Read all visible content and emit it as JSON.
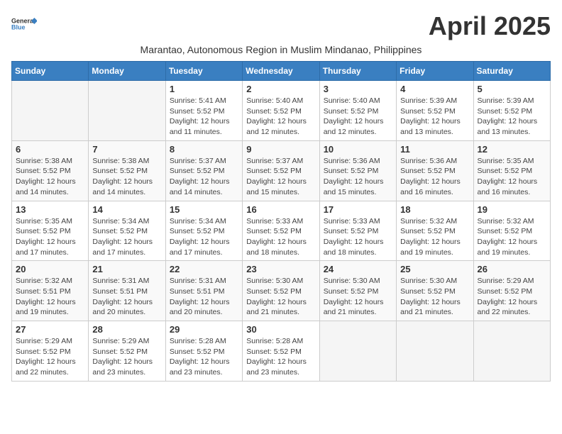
{
  "logo": {
    "text_general": "General",
    "text_blue": "Blue"
  },
  "title": "April 2025",
  "subtitle": "Marantao, Autonomous Region in Muslim Mindanao, Philippines",
  "days_of_week": [
    "Sunday",
    "Monday",
    "Tuesday",
    "Wednesday",
    "Thursday",
    "Friday",
    "Saturday"
  ],
  "weeks": [
    [
      {
        "day": "",
        "info": ""
      },
      {
        "day": "",
        "info": ""
      },
      {
        "day": "1",
        "info": "Sunrise: 5:41 AM\nSunset: 5:52 PM\nDaylight: 12 hours and 11 minutes."
      },
      {
        "day": "2",
        "info": "Sunrise: 5:40 AM\nSunset: 5:52 PM\nDaylight: 12 hours and 12 minutes."
      },
      {
        "day": "3",
        "info": "Sunrise: 5:40 AM\nSunset: 5:52 PM\nDaylight: 12 hours and 12 minutes."
      },
      {
        "day": "4",
        "info": "Sunrise: 5:39 AM\nSunset: 5:52 PM\nDaylight: 12 hours and 13 minutes."
      },
      {
        "day": "5",
        "info": "Sunrise: 5:39 AM\nSunset: 5:52 PM\nDaylight: 12 hours and 13 minutes."
      }
    ],
    [
      {
        "day": "6",
        "info": "Sunrise: 5:38 AM\nSunset: 5:52 PM\nDaylight: 12 hours and 14 minutes."
      },
      {
        "day": "7",
        "info": "Sunrise: 5:38 AM\nSunset: 5:52 PM\nDaylight: 12 hours and 14 minutes."
      },
      {
        "day": "8",
        "info": "Sunrise: 5:37 AM\nSunset: 5:52 PM\nDaylight: 12 hours and 14 minutes."
      },
      {
        "day": "9",
        "info": "Sunrise: 5:37 AM\nSunset: 5:52 PM\nDaylight: 12 hours and 15 minutes."
      },
      {
        "day": "10",
        "info": "Sunrise: 5:36 AM\nSunset: 5:52 PM\nDaylight: 12 hours and 15 minutes."
      },
      {
        "day": "11",
        "info": "Sunrise: 5:36 AM\nSunset: 5:52 PM\nDaylight: 12 hours and 16 minutes."
      },
      {
        "day": "12",
        "info": "Sunrise: 5:35 AM\nSunset: 5:52 PM\nDaylight: 12 hours and 16 minutes."
      }
    ],
    [
      {
        "day": "13",
        "info": "Sunrise: 5:35 AM\nSunset: 5:52 PM\nDaylight: 12 hours and 17 minutes."
      },
      {
        "day": "14",
        "info": "Sunrise: 5:34 AM\nSunset: 5:52 PM\nDaylight: 12 hours and 17 minutes."
      },
      {
        "day": "15",
        "info": "Sunrise: 5:34 AM\nSunset: 5:52 PM\nDaylight: 12 hours and 17 minutes."
      },
      {
        "day": "16",
        "info": "Sunrise: 5:33 AM\nSunset: 5:52 PM\nDaylight: 12 hours and 18 minutes."
      },
      {
        "day": "17",
        "info": "Sunrise: 5:33 AM\nSunset: 5:52 PM\nDaylight: 12 hours and 18 minutes."
      },
      {
        "day": "18",
        "info": "Sunrise: 5:32 AM\nSunset: 5:52 PM\nDaylight: 12 hours and 19 minutes."
      },
      {
        "day": "19",
        "info": "Sunrise: 5:32 AM\nSunset: 5:52 PM\nDaylight: 12 hours and 19 minutes."
      }
    ],
    [
      {
        "day": "20",
        "info": "Sunrise: 5:32 AM\nSunset: 5:51 PM\nDaylight: 12 hours and 19 minutes."
      },
      {
        "day": "21",
        "info": "Sunrise: 5:31 AM\nSunset: 5:51 PM\nDaylight: 12 hours and 20 minutes."
      },
      {
        "day": "22",
        "info": "Sunrise: 5:31 AM\nSunset: 5:51 PM\nDaylight: 12 hours and 20 minutes."
      },
      {
        "day": "23",
        "info": "Sunrise: 5:30 AM\nSunset: 5:52 PM\nDaylight: 12 hours and 21 minutes."
      },
      {
        "day": "24",
        "info": "Sunrise: 5:30 AM\nSunset: 5:52 PM\nDaylight: 12 hours and 21 minutes."
      },
      {
        "day": "25",
        "info": "Sunrise: 5:30 AM\nSunset: 5:52 PM\nDaylight: 12 hours and 21 minutes."
      },
      {
        "day": "26",
        "info": "Sunrise: 5:29 AM\nSunset: 5:52 PM\nDaylight: 12 hours and 22 minutes."
      }
    ],
    [
      {
        "day": "27",
        "info": "Sunrise: 5:29 AM\nSunset: 5:52 PM\nDaylight: 12 hours and 22 minutes."
      },
      {
        "day": "28",
        "info": "Sunrise: 5:29 AM\nSunset: 5:52 PM\nDaylight: 12 hours and 23 minutes."
      },
      {
        "day": "29",
        "info": "Sunrise: 5:28 AM\nSunset: 5:52 PM\nDaylight: 12 hours and 23 minutes."
      },
      {
        "day": "30",
        "info": "Sunrise: 5:28 AM\nSunset: 5:52 PM\nDaylight: 12 hours and 23 minutes."
      },
      {
        "day": "",
        "info": ""
      },
      {
        "day": "",
        "info": ""
      },
      {
        "day": "",
        "info": ""
      }
    ]
  ]
}
